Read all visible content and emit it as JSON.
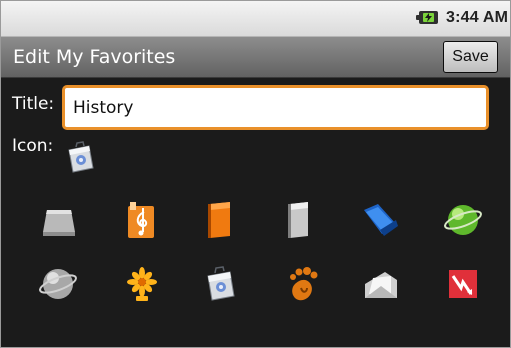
{
  "status_bar": {
    "time": "3:44 AM",
    "battery_icon": "battery-charging-icon",
    "battery_color": "#7ad33a"
  },
  "header": {
    "title": "Edit My Favorites",
    "save_label": "Save"
  },
  "form": {
    "title_label": "Title:",
    "title_value": "History",
    "icon_label": "Icon:",
    "selected_icon": "photo-bag-icon",
    "focus_color": "#e9902a"
  },
  "icon_grid": [
    [
      "drive-icon",
      "music-note-icon",
      "orange-book-icon",
      "gray-book-icon",
      "blue-folder-icon",
      "green-globe-icon"
    ],
    [
      "gray-globe-icon",
      "yellow-flower-icon",
      "photo-bag-icon",
      "gnome-foot-icon",
      "open-envelope-icon",
      "red-lightning-icon"
    ]
  ]
}
